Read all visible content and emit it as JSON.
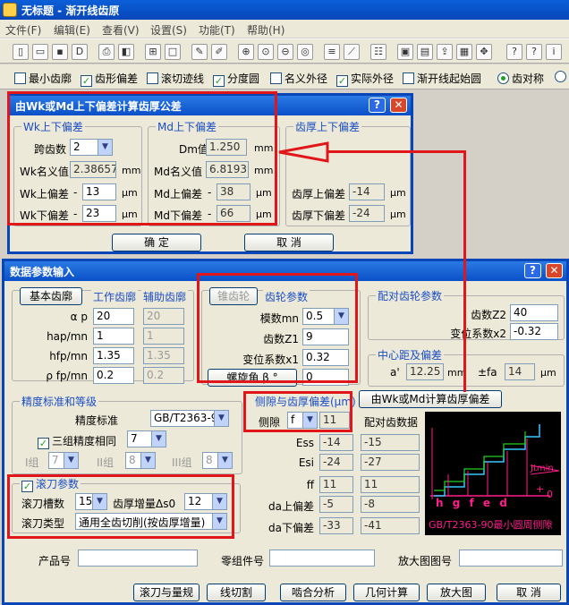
{
  "window": {
    "title": "无标题 - 渐开线齿原"
  },
  "menu": [
    "文件(F)",
    "编辑(E)",
    "查看(V)",
    "设置(S)",
    "功能(T)",
    "帮助(H)"
  ],
  "options": [
    {
      "label": "最小齿廓",
      "checked": false,
      "kind": "check"
    },
    {
      "label": "齿形偏差",
      "checked": true,
      "kind": "check"
    },
    {
      "label": "滚切迹线",
      "checked": false,
      "kind": "check"
    },
    {
      "label": "分度圆",
      "checked": true,
      "kind": "check"
    },
    {
      "label": "名义外径",
      "checked": false,
      "kind": "check"
    },
    {
      "label": "实际外径",
      "checked": true,
      "kind": "check"
    },
    {
      "label": "渐开线起始圆",
      "checked": false,
      "kind": "check"
    },
    {
      "label": "齿对称",
      "checked": true,
      "kind": "radio"
    }
  ],
  "dialog1": {
    "title": "由Wk或Md上下偏差计算齿厚公差",
    "wk_group": {
      "title": "Wk上下偏差",
      "span_label": "跨齿数",
      "span_value": "2",
      "name_label": "Wk名义值",
      "name_value": "2.38657",
      "name_unit": "mm",
      "upper_label": "Wk上偏差",
      "upper_value": "13",
      "lower_label": "Wk下偏差",
      "lower_value": "23",
      "micron": "μm",
      "minus": "-"
    },
    "md_group": {
      "title": "Md上下偏差",
      "dm_label": "Dm值",
      "dm_value": "1.250",
      "dm_unit": "mm",
      "name_label": "Md名义值",
      "name_value": "6.81931",
      "name_unit": "mm",
      "upper_label": "Md上偏差",
      "upper_value": "38",
      "lower_label": "Md下偏差",
      "lower_value": "66",
      "micron": "μm",
      "minus": "-"
    },
    "thick_group": {
      "title": "齿厚上下偏差",
      "upper_label": "齿厚上偏差",
      "upper_value": "-14",
      "lower_label": "齿厚下偏差",
      "lower_value": "-24",
      "micron": "μm"
    },
    "ok": "确 定",
    "cancel": "取 消"
  },
  "dialog2": {
    "title": "数据参数输入",
    "tabs": {
      "basic": "基本齿廓",
      "work": "工作齿廓",
      "aux": "辅助齿廓"
    },
    "basic_rows": [
      {
        "label": "α p",
        "v1": "20",
        "v2": "20"
      },
      {
        "label": "hap/mn",
        "v1": "1",
        "v2": "1"
      },
      {
        "label": "hfp/mn",
        "v1": "1.35",
        "v2": "1.35"
      },
      {
        "label": "ρ fp/mn",
        "v1": "0.2",
        "v2": "0.2"
      }
    ],
    "gear": {
      "tab_bevel": "锥齿轮",
      "tab_gear": "齿轮参数",
      "module_label": "模数mn",
      "module_value": "0.5",
      "teeth_label": "齿数Z1",
      "teeth_value": "9",
      "shift_label": "变位系数x1",
      "shift_value": "0.32",
      "helix_btn": "螺旋角 β °",
      "helix_value": "0"
    },
    "mate": {
      "title": "配对齿轮参数",
      "teeth_label": "齿数Z2",
      "teeth_value": "40",
      "shift_label": "变位系数x2",
      "shift_value": "-0.32"
    },
    "center": {
      "title": "中心距及偏差",
      "a_label": "a'",
      "a_value": "12.25",
      "a_unit": "mm",
      "fa_label": "±fa",
      "fa_value": "14",
      "fa_unit": "μm"
    },
    "calc_btn": "由Wk或Md计算齿厚偏差",
    "precision": {
      "title": "精度标准和等级",
      "std_label": "精度标准",
      "std_value": "GB/T2363-90",
      "same_label": "三组精度相同",
      "same_value": "7",
      "g1": "I组",
      "g1v": "7",
      "g2": "II组",
      "g2v": "8",
      "g3": "III组",
      "g3v": "8"
    },
    "backlash": {
      "title": "侧隙与齿厚偏差(μm)",
      "gap_label": "侧隙",
      "gap_value": "f",
      "gap_num": "11",
      "pair_label": "配对齿数据",
      "rows": [
        {
          "label": "Ess",
          "v1": "-14",
          "v2": "-15"
        },
        {
          "label": "Esi",
          "v1": "-24",
          "v2": "-27"
        },
        {
          "label": "ff",
          "v1": "11",
          "v2": "11"
        },
        {
          "label": "da上偏差",
          "v1": "-5",
          "v2": "-8"
        },
        {
          "label": "da下偏差",
          "v1": "-33",
          "v2": "-41"
        }
      ]
    },
    "graph": {
      "letters": "h g f e d",
      "jtmin": "Jtmin",
      "plus": "+",
      "zero": "0",
      "caption": "GB/T2363-90最小圆周侧隙"
    },
    "hob": {
      "title": "滚刀参数",
      "slots_label": "滚刀槽数",
      "slots_value": "15",
      "inc_label": "齿厚增量Δs0",
      "inc_value": "12",
      "type_label": "滚刀类型",
      "type_value": "通用全齿切削(按齿厚增量)"
    },
    "product": {
      "prod_label": "产品号",
      "part_label": "零组件号",
      "zoom_label": "放大图图号"
    },
    "buttons": [
      "滚刀与量规",
      "线切割",
      "啮合分析",
      "几何计算",
      "放大图",
      "取 消"
    ]
  }
}
